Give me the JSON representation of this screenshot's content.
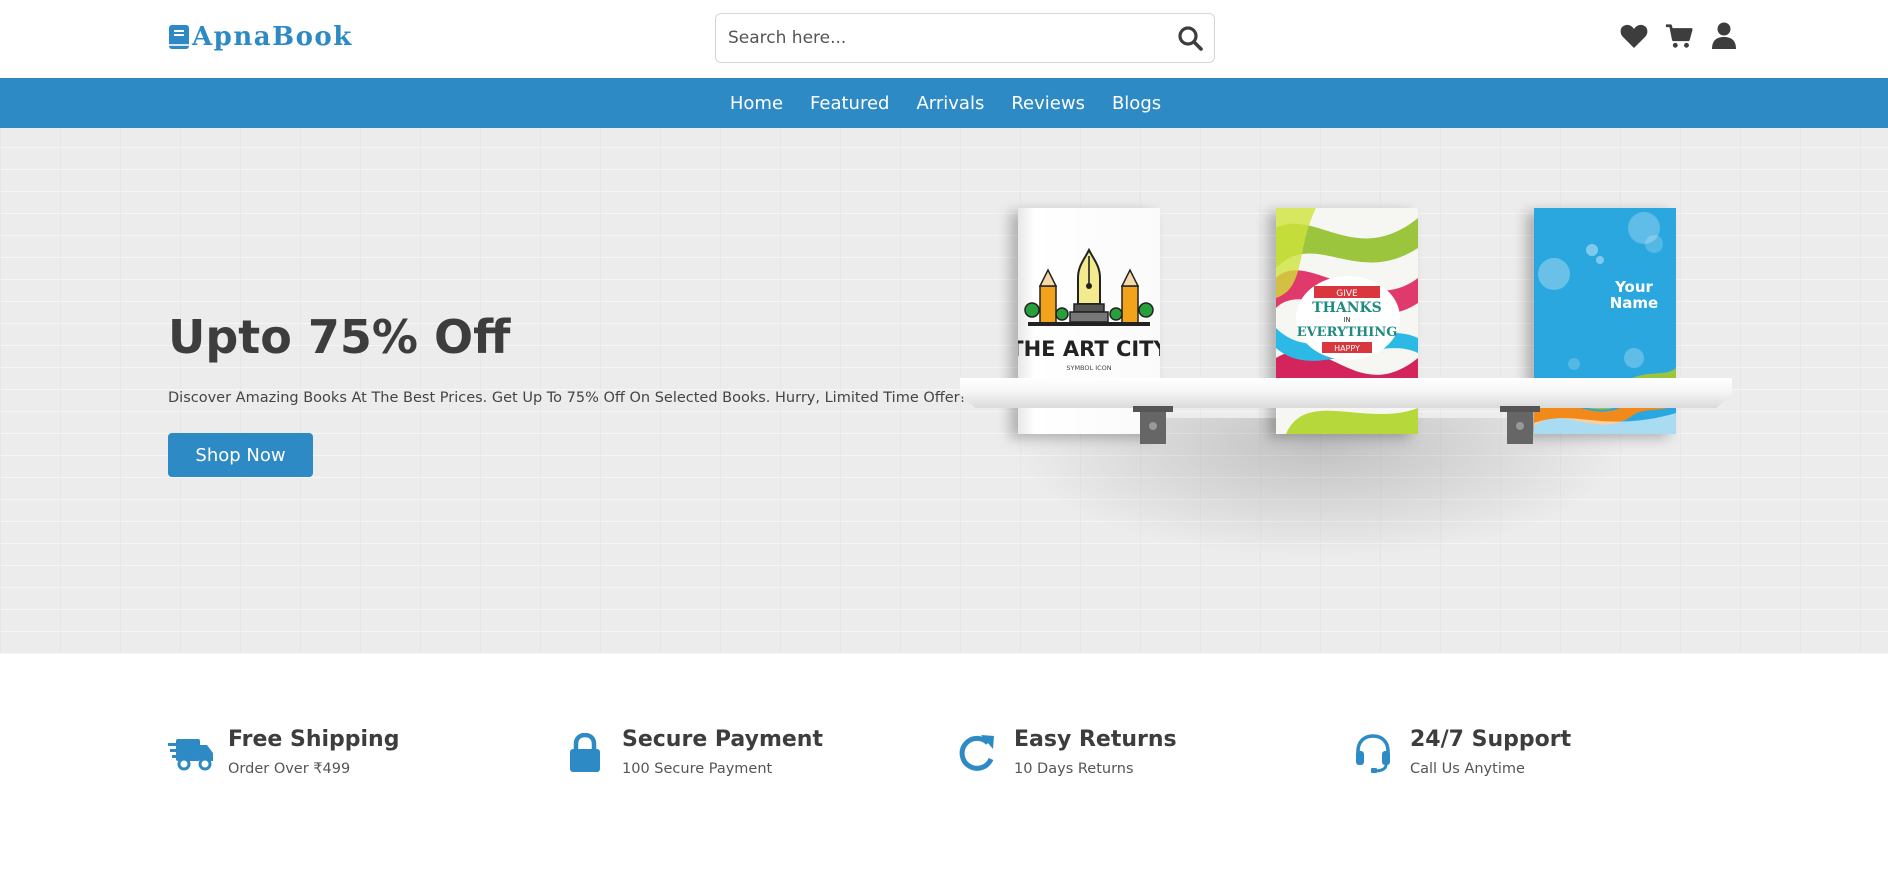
{
  "brand": {
    "name": "ApnaBook",
    "color": "#2e8ac4",
    "icon": "book-icon"
  },
  "search": {
    "placeholder": "Search here...",
    "value": "",
    "icon": "search-icon"
  },
  "header_icons": [
    "heart-icon",
    "cart-icon",
    "user-icon"
  ],
  "nav": {
    "items": [
      "Home",
      "Featured",
      "Arrivals",
      "Reviews",
      "Blogs"
    ]
  },
  "hero": {
    "title": "Upto 75% Off",
    "subtitle": "Discover Amazing Books At The Best Prices. Get Up To 75% Off On Selected Books. Hurry, Limited Time Offer!",
    "button": "Shop Now",
    "books": [
      {
        "title": "THE ART CITY",
        "subtitle": "SYMBOL ICON"
      },
      {
        "lines": [
          "GIVE",
          "THANKS",
          "IN",
          "EVERYTHING",
          "HAPPY"
        ]
      },
      {
        "lines": [
          "Your",
          "Name"
        ]
      }
    ]
  },
  "features": [
    {
      "icon": "truck-icon",
      "title": "Free Shipping",
      "subtitle": "Order Over ₹499"
    },
    {
      "icon": "lock-icon",
      "title": "Secure Payment",
      "subtitle": "100 Secure Payment"
    },
    {
      "icon": "redo-icon",
      "title": "Easy Returns",
      "subtitle": "10 Days Returns"
    },
    {
      "icon": "headset-icon",
      "title": "24/7 Support",
      "subtitle": "Call Us Anytime"
    }
  ],
  "colors": {
    "primary": "#2e8ac4",
    "text": "#3d3d3d",
    "hero_bg": "#ececec"
  }
}
